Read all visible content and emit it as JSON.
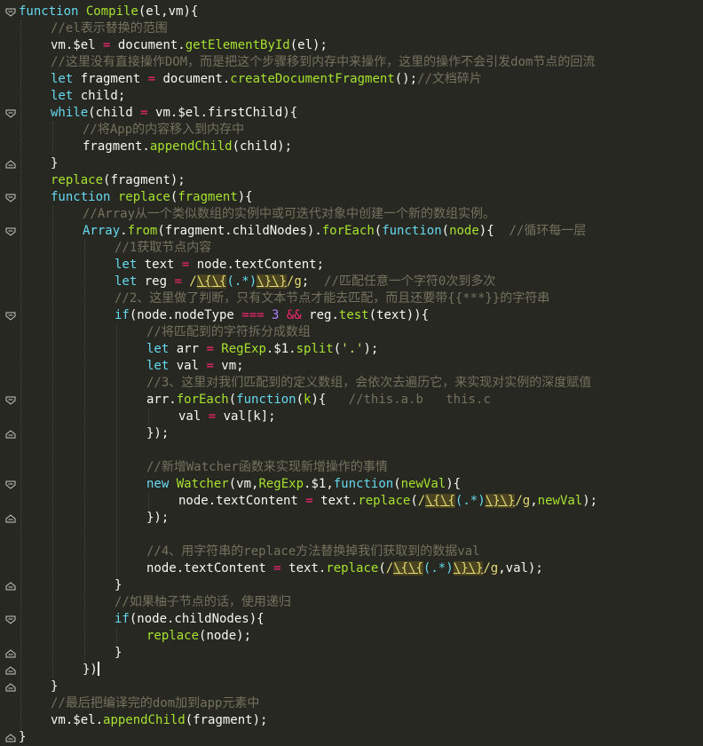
{
  "editor": {
    "theme_colors": {
      "background": "#272822",
      "text": "#f8f8f2",
      "keyword": "#66d9ef",
      "function": "#a6e22e",
      "comment": "#75715e",
      "string": "#e6db74",
      "number": "#ae81ff"
    },
    "lines": [
      {
        "indent": 0,
        "tokens": [
          [
            "kw",
            "function "
          ],
          [
            "fn",
            "Compile"
          ],
          [
            "",
            "(el,vm){"
          ]
        ]
      },
      {
        "indent": 1,
        "tokens": [
          [
            "cm",
            "//el表示替换的范围"
          ]
        ]
      },
      {
        "indent": 1,
        "tokens": [
          [
            "",
            "vm.$el "
          ],
          [
            "pr",
            "= "
          ],
          [
            "",
            "document."
          ],
          [
            "fn",
            "getElementById"
          ],
          [
            "",
            "(el);"
          ]
        ]
      },
      {
        "indent": 1,
        "tokens": [
          [
            "cm",
            "//这里没有直接操作DOM，而是把这个步骤移到内存中来操作，这里的操作不会引发dom节点的回流"
          ]
        ]
      },
      {
        "indent": 1,
        "tokens": [
          [
            "kw",
            "let "
          ],
          [
            "",
            "fragment "
          ],
          [
            "pr",
            "= "
          ],
          [
            "",
            "document."
          ],
          [
            "fn",
            "createDocumentFragment"
          ],
          [
            "",
            "();"
          ],
          [
            "cm",
            "//文档碎片"
          ]
        ]
      },
      {
        "indent": 1,
        "tokens": [
          [
            "kw",
            "let "
          ],
          [
            "",
            "child;"
          ]
        ]
      },
      {
        "indent": 1,
        "tokens": [
          [
            "kw",
            "while"
          ],
          [
            "",
            "(child "
          ],
          [
            "pr",
            "= "
          ],
          [
            "",
            "vm.$el.firstChild){"
          ]
        ]
      },
      {
        "indent": 2,
        "tokens": [
          [
            "cm",
            "//将App的内容移入到内存中"
          ]
        ]
      },
      {
        "indent": 2,
        "tokens": [
          [
            "",
            "fragment."
          ],
          [
            "fn",
            "appendChild"
          ],
          [
            "",
            "(child);"
          ]
        ]
      },
      {
        "indent": 1,
        "tokens": [
          [
            "",
            "}"
          ]
        ]
      },
      {
        "indent": 1,
        "tokens": [
          [
            "fn",
            "replace"
          ],
          [
            "",
            "(fragment);"
          ]
        ]
      },
      {
        "indent": 1,
        "tokens": [
          [
            "kw",
            "function "
          ],
          [
            "fn",
            "replace"
          ],
          [
            "",
            "("
          ],
          [
            "fn",
            "fragment"
          ],
          [
            "",
            "){"
          ]
        ]
      },
      {
        "indent": 2,
        "tokens": [
          [
            "cm",
            "//Array从一个类似数组的实例中或可迭代对象中创建一个新的数组实例。"
          ]
        ]
      },
      {
        "indent": 2,
        "tokens": [
          [
            "kw",
            "Array"
          ],
          [
            "",
            "."
          ],
          [
            "fn",
            "from"
          ],
          [
            "",
            "(fragment.childNodes)."
          ],
          [
            "fn",
            "forEach"
          ],
          [
            "",
            "("
          ],
          [
            "kw",
            "function"
          ],
          [
            "",
            "("
          ],
          [
            "fn",
            "node"
          ],
          [
            "",
            "){  "
          ],
          [
            "cm",
            "//循环每一层"
          ]
        ]
      },
      {
        "indent": 3,
        "tokens": [
          [
            "cm",
            "//1获取节点内容"
          ]
        ]
      },
      {
        "indent": 3,
        "tokens": [
          [
            "kw",
            "let "
          ],
          [
            "",
            "text "
          ],
          [
            "pr",
            "= "
          ],
          [
            "",
            "node.textContent;"
          ]
        ]
      },
      {
        "indent": 3,
        "tokens": [
          [
            "kw",
            "let "
          ],
          [
            "",
            "reg "
          ],
          [
            "pr",
            "= "
          ],
          [
            "rx",
            "/"
          ],
          [
            "rxh",
            "\\{\\{"
          ],
          [
            "rxb",
            "(.*)"
          ],
          [
            "rxh",
            "\\}\\}"
          ],
          [
            "rx",
            "/g"
          ],
          [
            "",
            ";  "
          ],
          [
            "cm",
            "//匹配任意一个字符0次到多次"
          ]
        ]
      },
      {
        "indent": 3,
        "tokens": [
          [
            "cm",
            "//2、这里做了判断，只有文本节点才能去匹配，而且还要带{{***}}的字符串"
          ]
        ]
      },
      {
        "indent": 3,
        "tokens": [
          [
            "kw",
            "if"
          ],
          [
            "",
            "(node.nodeType "
          ],
          [
            "pr",
            "=== "
          ],
          [
            "nm",
            "3 "
          ],
          [
            "pr",
            "&& "
          ],
          [
            "",
            "reg."
          ],
          [
            "fn",
            "test"
          ],
          [
            "",
            "(text)){"
          ]
        ]
      },
      {
        "indent": 4,
        "tokens": [
          [
            "cm",
            "//将匹配到的字符拆分成数组"
          ]
        ]
      },
      {
        "indent": 4,
        "tokens": [
          [
            "kw",
            "let "
          ],
          [
            "",
            "arr "
          ],
          [
            "pr",
            "= "
          ],
          [
            "fn",
            "RegExp"
          ],
          [
            "",
            ".$1."
          ],
          [
            "fn",
            "split"
          ],
          [
            "",
            "("
          ],
          [
            "st",
            "'.'"
          ],
          [
            "",
            ");"
          ]
        ]
      },
      {
        "indent": 4,
        "tokens": [
          [
            "kw",
            "let "
          ],
          [
            "",
            "val "
          ],
          [
            "pr",
            "= "
          ],
          [
            "",
            "vm;"
          ]
        ]
      },
      {
        "indent": 4,
        "tokens": [
          [
            "cm",
            "//3、这里对我们匹配到的定义数组，会依次去遍历它，来实现对实例的深度赋值"
          ]
        ]
      },
      {
        "indent": 4,
        "tokens": [
          [
            "",
            "arr."
          ],
          [
            "fn",
            "forEach"
          ],
          [
            "",
            "("
          ],
          [
            "kw",
            "function"
          ],
          [
            "",
            "("
          ],
          [
            "fn",
            "k"
          ],
          [
            "",
            "){   "
          ],
          [
            "cmz",
            "//this.a.b   this.c"
          ]
        ]
      },
      {
        "indent": 5,
        "tokens": [
          [
            "",
            "val "
          ],
          [
            "pr",
            "= "
          ],
          [
            "",
            "val[k];"
          ]
        ]
      },
      {
        "indent": 4,
        "tokens": [
          [
            "",
            "});"
          ]
        ]
      },
      {
        "indent": 4,
        "tokens": []
      },
      {
        "indent": 4,
        "tokens": [
          [
            "cm",
            "//新增Watcher函数来实现新增操作的事情"
          ]
        ]
      },
      {
        "indent": 4,
        "tokens": [
          [
            "kw",
            "new "
          ],
          [
            "fn",
            "Watcher"
          ],
          [
            "",
            "(vm,"
          ],
          [
            "fn",
            "RegExp"
          ],
          [
            "",
            ".$1,"
          ],
          [
            "kw",
            "function"
          ],
          [
            "",
            "("
          ],
          [
            "fn",
            "newVal"
          ],
          [
            "",
            "){"
          ]
        ]
      },
      {
        "indent": 5,
        "tokens": [
          [
            "",
            "node.textContent "
          ],
          [
            "pr",
            "= "
          ],
          [
            "",
            "text."
          ],
          [
            "fn",
            "replace"
          ],
          [
            "",
            "("
          ],
          [
            "rx",
            "/"
          ],
          [
            "rxh",
            "\\{\\{"
          ],
          [
            "rxb",
            "(.*)"
          ],
          [
            "rxh",
            "\\}\\}"
          ],
          [
            "rx",
            "/g"
          ],
          [
            "",
            ","
          ],
          [
            "fn",
            "newVal"
          ],
          [
            "",
            ");"
          ]
        ]
      },
      {
        "indent": 4,
        "tokens": [
          [
            "",
            "});"
          ]
        ]
      },
      {
        "indent": 4,
        "tokens": []
      },
      {
        "indent": 4,
        "tokens": [
          [
            "cm",
            "//4、用字符串的replace方法替换掉我们获取到的数据val"
          ]
        ]
      },
      {
        "indent": 4,
        "tokens": [
          [
            "",
            "node.textContent "
          ],
          [
            "pr",
            "= "
          ],
          [
            "",
            "text."
          ],
          [
            "fn",
            "replace"
          ],
          [
            "",
            "("
          ],
          [
            "rx",
            "/"
          ],
          [
            "rxh",
            "\\{\\{"
          ],
          [
            "rxb",
            "(.*)"
          ],
          [
            "rxh",
            "\\}\\}"
          ],
          [
            "rx",
            "/g"
          ],
          [
            "",
            ",val);"
          ]
        ]
      },
      {
        "indent": 3,
        "tokens": [
          [
            "",
            "}"
          ]
        ]
      },
      {
        "indent": 3,
        "tokens": [
          [
            "cm",
            "//如果柚子节点的话，使用递归"
          ]
        ]
      },
      {
        "indent": 3,
        "tokens": [
          [
            "kw",
            "if"
          ],
          [
            "",
            "(node.childNodes){"
          ]
        ]
      },
      {
        "indent": 4,
        "tokens": [
          [
            "fn",
            "replace"
          ],
          [
            "",
            "(node);"
          ]
        ]
      },
      {
        "indent": 3,
        "tokens": [
          [
            "",
            "}"
          ]
        ]
      },
      {
        "indent": 2,
        "tokens": [
          [
            "",
            "})"
          ]
        ],
        "cursor": true
      },
      {
        "indent": 1,
        "tokens": [
          [
            "",
            "}"
          ]
        ]
      },
      {
        "indent": 1,
        "tokens": [
          [
            "cm",
            "//最后把编译完的dom加到app元素中"
          ]
        ]
      },
      {
        "indent": 1,
        "tokens": [
          [
            "",
            "vm.$el."
          ],
          [
            "fn",
            "appendChild"
          ],
          [
            "",
            "(fragment);"
          ]
        ]
      },
      {
        "indent": 0,
        "tokens": [
          [
            "",
            "}"
          ]
        ]
      }
    ],
    "fold_markers": [
      {
        "line": 0,
        "kind": "open"
      },
      {
        "line": 6,
        "kind": "open"
      },
      {
        "line": 9,
        "kind": "close"
      },
      {
        "line": 11,
        "kind": "open"
      },
      {
        "line": 13,
        "kind": "open"
      },
      {
        "line": 18,
        "kind": "open"
      },
      {
        "line": 23,
        "kind": "open"
      },
      {
        "line": 25,
        "kind": "close"
      },
      {
        "line": 28,
        "kind": "open"
      },
      {
        "line": 30,
        "kind": "close"
      },
      {
        "line": 34,
        "kind": "close"
      },
      {
        "line": 36,
        "kind": "open"
      },
      {
        "line": 38,
        "kind": "close"
      },
      {
        "line": 39,
        "kind": "close"
      },
      {
        "line": 40,
        "kind": "close"
      },
      {
        "line": 43,
        "kind": "close"
      }
    ]
  }
}
